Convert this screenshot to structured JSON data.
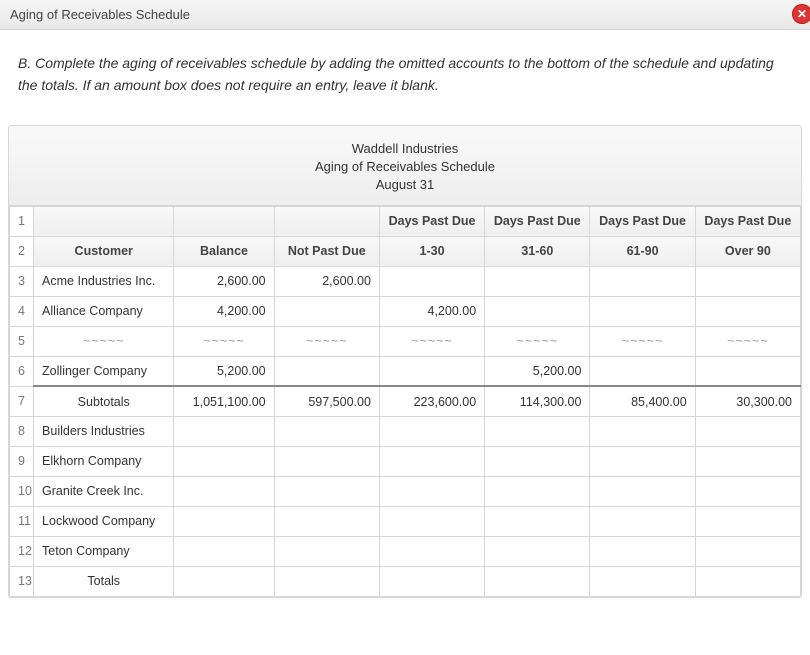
{
  "titlebar": {
    "title": "Aging of Receivables Schedule"
  },
  "instructions": "B. Complete the aging of receivables schedule by adding the omitted accounts to the bottom of the schedule and updating the totals. If an amount box does not require an entry, leave it blank.",
  "sheet": {
    "company": "Waddell Industries",
    "report_title": "Aging of Receivables Schedule",
    "as_of": "August 31",
    "group_header": "Days Past Due",
    "columns": {
      "customer": "Customer",
      "balance": "Balance",
      "not_past_due": "Not Past Due",
      "b1_30": "1-30",
      "b31_60": "31-60",
      "b61_90": "61-90",
      "over_90": "Over 90"
    },
    "rows": [
      {
        "n": "1",
        "type": "group_header"
      },
      {
        "n": "2",
        "type": "col_header"
      },
      {
        "n": "3",
        "type": "data",
        "customer": "Acme Industries Inc.",
        "balance": "2,600.00",
        "not_past_due": "2,600.00",
        "b1_30": "",
        "b31_60": "",
        "b61_90": "",
        "over_90": ""
      },
      {
        "n": "4",
        "type": "data",
        "customer": "Alliance Company",
        "balance": "4,200.00",
        "not_past_due": "",
        "b1_30": "4,200.00",
        "b31_60": "",
        "b61_90": "",
        "over_90": ""
      },
      {
        "n": "5",
        "type": "ellipsis"
      },
      {
        "n": "6",
        "type": "data",
        "customer": "Zollinger Company",
        "balance": "5,200.00",
        "not_past_due": "",
        "b1_30": "",
        "b31_60": "5,200.00",
        "b61_90": "",
        "over_90": ""
      },
      {
        "n": "7",
        "type": "subtotal",
        "customer": "Subtotals",
        "balance": "1,051,100.00",
        "not_past_due": "597,500.00",
        "b1_30": "223,600.00",
        "b31_60": "114,300.00",
        "b61_90": "85,400.00",
        "over_90": "30,300.00"
      },
      {
        "n": "8",
        "type": "entry",
        "customer": "Builders Industries"
      },
      {
        "n": "9",
        "type": "entry",
        "customer": "Elkhorn Company"
      },
      {
        "n": "10",
        "type": "entry",
        "customer": "Granite Creek Inc."
      },
      {
        "n": "11",
        "type": "entry",
        "customer": "Lockwood Company"
      },
      {
        "n": "12",
        "type": "entry",
        "customer": "Teton Company"
      },
      {
        "n": "13",
        "type": "totals",
        "customer": "Totals"
      }
    ],
    "wavy": "~~~~~"
  }
}
